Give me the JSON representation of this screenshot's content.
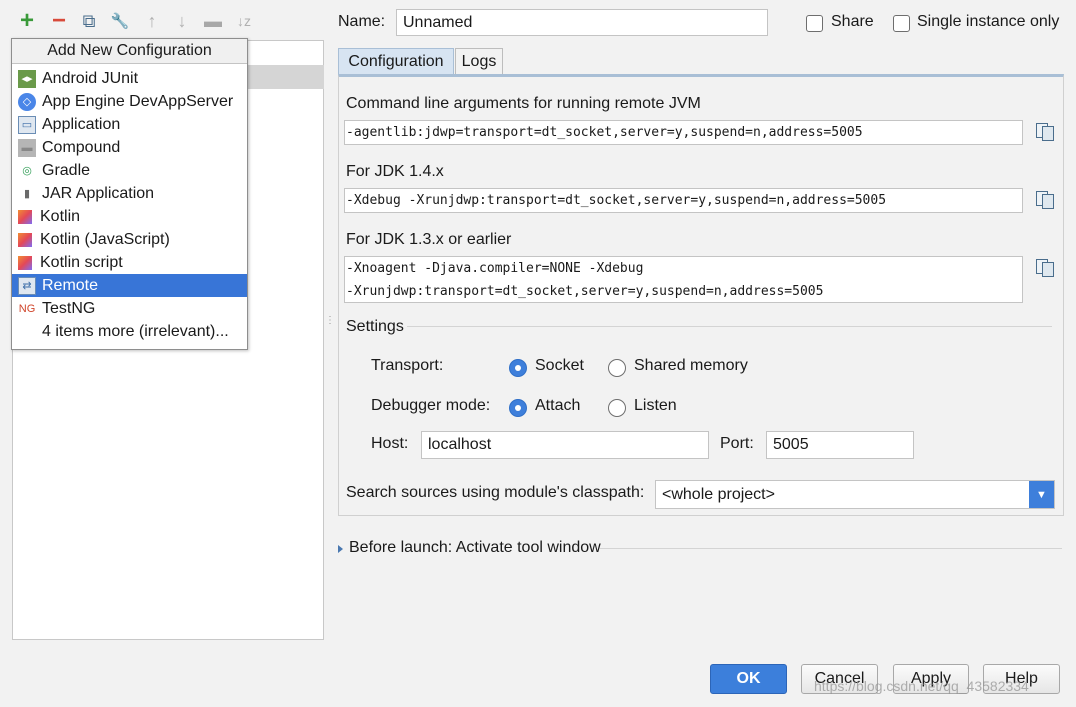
{
  "toolbar": {
    "add": "+",
    "remove": "−",
    "copy": "⧉",
    "edit": "🔧",
    "up": "↑",
    "down": "↓",
    "folder": "▬",
    "sort": "↓z"
  },
  "popup": {
    "title": "Add New Configuration",
    "items": [
      {
        "label": "Android JUnit",
        "icon": "android-junit-icon"
      },
      {
        "label": "App Engine DevAppServer",
        "icon": "app-engine-icon"
      },
      {
        "label": "Application",
        "icon": "application-icon"
      },
      {
        "label": "Compound",
        "icon": "compound-icon"
      },
      {
        "label": "Gradle",
        "icon": "gradle-icon"
      },
      {
        "label": "JAR Application",
        "icon": "jar-icon"
      },
      {
        "label": "Kotlin",
        "icon": "kotlin-icon"
      },
      {
        "label": "Kotlin (JavaScript)",
        "icon": "kotlin-icon"
      },
      {
        "label": "Kotlin script",
        "icon": "kotlin-icon"
      },
      {
        "label": "Remote",
        "icon": "remote-icon"
      },
      {
        "label": "TestNG",
        "icon": "testng-icon"
      },
      {
        "label": "4 items more (irrelevant)...",
        "icon": ""
      }
    ],
    "selected": "Remote"
  },
  "form": {
    "name_label": "Name:",
    "name_value": "Unnamed",
    "share_label": "Share",
    "single_instance_label": "Single instance only",
    "tabs": [
      "Configuration",
      "Logs"
    ],
    "cmd_label": "Command line arguments for running remote JVM",
    "cmd_value": "-agentlib:jdwp=transport=dt_socket,server=y,suspend=n,address=5005",
    "jdk14_label": "For JDK 1.4.x",
    "jdk14_value": "-Xdebug -Xrunjdwp:transport=dt_socket,server=y,suspend=n,address=5005",
    "jdk13_label": "For JDK 1.3.x or earlier",
    "jdk13_line1": "-Xnoagent -Djava.compiler=NONE -Xdebug",
    "jdk13_line2": "-Xrunjdwp:transport=dt_socket,server=y,suspend=n,address=5005",
    "settings_label": "Settings",
    "transport_label": "Transport:",
    "socket_label": "Socket",
    "shared_memory_label": "Shared memory",
    "debugger_mode_label": "Debugger mode:",
    "attach_label": "Attach",
    "listen_label": "Listen",
    "host_label": "Host:",
    "host_value": "localhost",
    "port_label": "Port:",
    "port_value": "5005",
    "search_label": "Search sources using module's classpath:",
    "search_value": "<whole project>",
    "before_launch_label": "Before launch: Activate tool window"
  },
  "buttons": {
    "ok": "OK",
    "cancel": "Cancel",
    "apply": "Apply",
    "help": "Help"
  },
  "watermark": "https://blog.csdn.net/qq_43582334",
  "colors": {
    "accent": "#3875d7",
    "ok_button": "#3c7fdb"
  }
}
